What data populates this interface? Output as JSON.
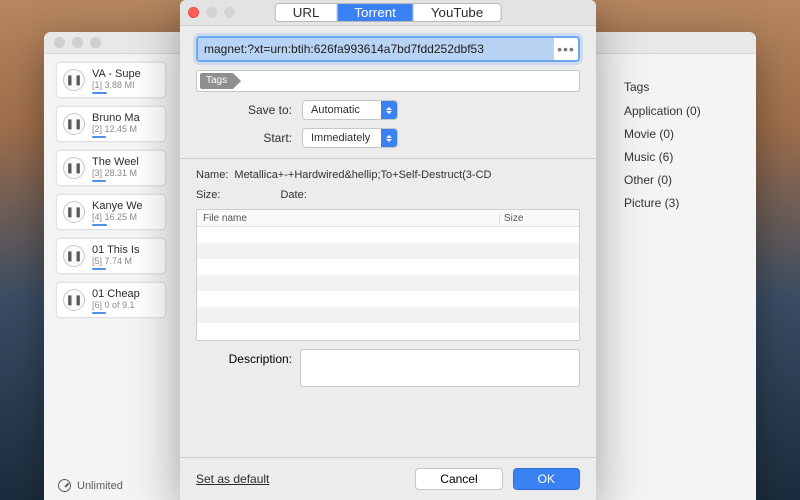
{
  "back": {
    "status": "Unlimited",
    "tags_header": "Tags",
    "tags": [
      {
        "label": "Application (0)"
      },
      {
        "label": "Movie (0)"
      },
      {
        "label": "Music (6)"
      },
      {
        "label": "Other (0)"
      },
      {
        "label": "Picture (3)"
      }
    ],
    "downloads": [
      {
        "title": "VA - Supe",
        "sub": "[1]  3.88 MI"
      },
      {
        "title": "Bruno Ma",
        "sub": "[2]  12.45 M"
      },
      {
        "title": "The Weel",
        "sub": "[3]  28.31 M"
      },
      {
        "title": "Kanye We",
        "sub": "[4]  16.25 M"
      },
      {
        "title": "01 This Is",
        "sub": "[5]  7.74 M"
      },
      {
        "title": "01 Cheap",
        "sub": "[6]  0 of 9.1"
      }
    ]
  },
  "sheet": {
    "tabs": {
      "url": "URL",
      "torrent": "Torrent",
      "youtube": "YouTube"
    },
    "url_value": "magnet:?xt=urn:btih:626fa993614a7bd7fdd252dbf53",
    "tags_chip": "Tags",
    "save_to_label": "Save to:",
    "save_to_value": "Automatic",
    "start_label": "Start:",
    "start_value": "Immediately",
    "name_label": "Name:",
    "name_value": "Metallica+-+Hardwired&hellip;To+Self-Destruct(3-CD",
    "size_label": "Size:",
    "date_label": "Date:",
    "col_file": "File name",
    "col_size": "Size",
    "desc_label": "Description:",
    "set_default": "Set as default",
    "cancel": "Cancel",
    "ok": "OK"
  }
}
